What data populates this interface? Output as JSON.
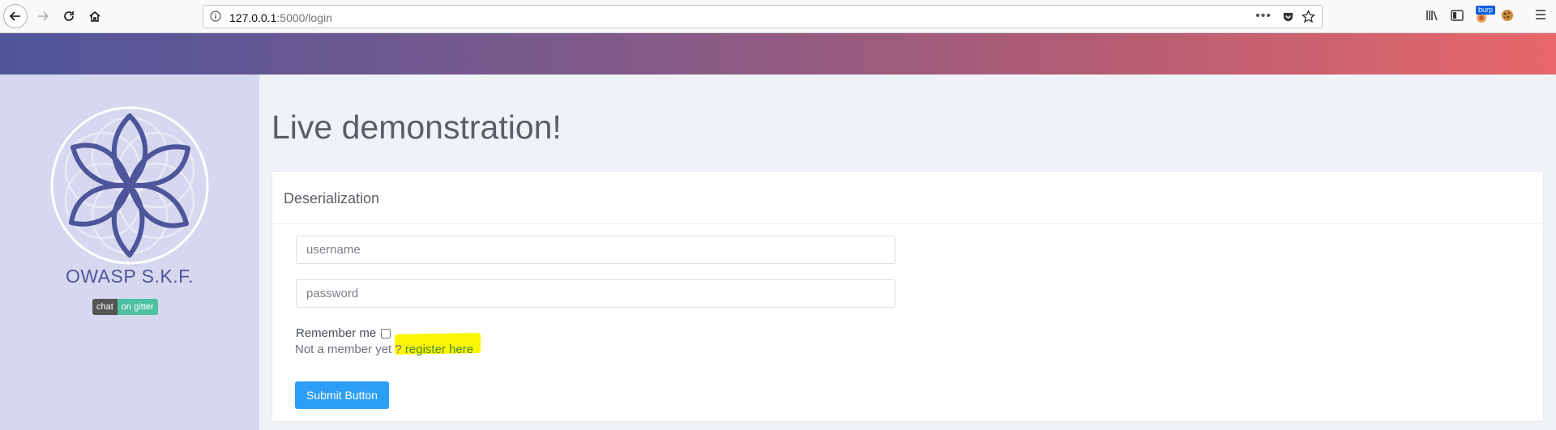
{
  "browser": {
    "url_host": "127.0.0.1",
    "url_rest": ":5000/login",
    "more_label": "•••",
    "extension_badge": "burp"
  },
  "sidebar": {
    "brand": "OWASP S.K.F.",
    "gitter_left": "chat",
    "gitter_right": "on gitter"
  },
  "main": {
    "title": "Live demonstration!",
    "card_title": "Deserialization",
    "username_placeholder": "username",
    "password_placeholder": "password",
    "remember_label": "Remember me",
    "not_member_text": "Not a member yet ? ",
    "register_link": "register here",
    "submit_label": "Submit Button"
  },
  "colors": {
    "banner_start": "#4f559b",
    "banner_end": "#e8676a",
    "sidebar_bg": "#d6d8ef",
    "submit_bg": "#2d9ef5",
    "highlight": "#fbf605"
  }
}
